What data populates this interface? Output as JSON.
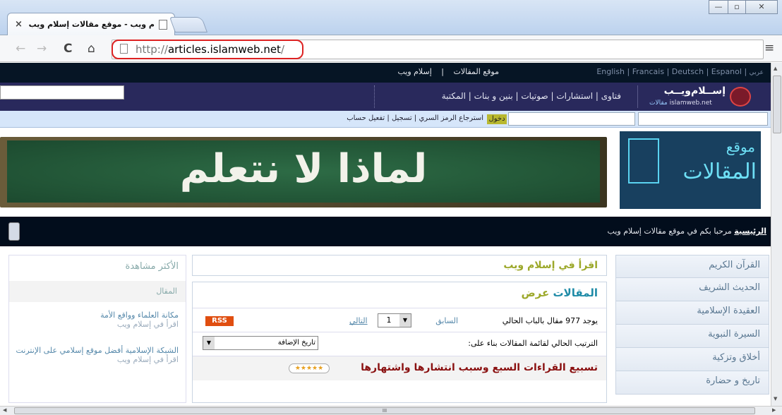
{
  "browser": {
    "tab_title": "م ويب - موقع مقالات إسلام ويب",
    "tab_close": "×",
    "url_scheme": "http://",
    "url_host": "articles.islamweb.net",
    "url_path": "/",
    "menu_icon": "≡"
  },
  "window": {
    "minimize": "—",
    "maximize": "▫",
    "close": "✕"
  },
  "topbar": {
    "langs": [
      "عربي",
      "Espanol",
      "Deutsch",
      "Francais",
      "English"
    ],
    "links": [
      "موقع المقالات",
      "إسلام ويب"
    ]
  },
  "header": {
    "logo_ar": "إســلام‌ويــب",
    "logo_sub": "مقالات",
    "logo_en": "islamweb.net",
    "nav": "فتاوى | استشارات | صوتيات | بنين و بنات | المكتبة"
  },
  "login": {
    "login_btn": "دخول",
    "recover": "استرجاع الرمز السري",
    "register": "تسجيل",
    "activate": "تفعيل حساب"
  },
  "banner": {
    "headline": "لماذا لا نتعلم",
    "site_label": "موقع",
    "site_name": "المقالات"
  },
  "breadcrumb": {
    "home": "الرئيسية",
    "welcome": "مرحبا بكم في موقع مقالات إسلام ويب"
  },
  "sidebar": {
    "items": [
      "القرآن الكريم",
      "الحديث الشريف",
      "العقيدة الإسلامية",
      "السيرة النبوية",
      "أخلاق وتزكية",
      "تاريخ و حضارة"
    ]
  },
  "main": {
    "read_title": "اقرأ في إسلام ويب",
    "view_title_a": "عرض",
    "view_title_b": "المقالات",
    "count_text": "يوجد 977 مقال بالباب الحالي",
    "prev": "السابق",
    "page": "1",
    "next": "التالي",
    "rss": "RSS",
    "sort_label": "الترتيب الحالي لقائمة المقالات بناء على:",
    "sort_value": "تاريخ الإضافة",
    "article_title": "تسبيع القراءات السبع وسبب انتشارها واشتهارها",
    "stars": "★★★★★"
  },
  "popular": {
    "title": "الأكثر مشاهدة",
    "col": "المقال",
    "items": [
      {
        "title": "مكانة العلماء وواقع الأمة",
        "src": "اقرأ في إسلام ويب"
      },
      {
        "title": "الشبكة الإسلامية أفضل موقع إسلامي على الإنترنت",
        "src": "اقرأ في إسلام ويب"
      }
    ]
  },
  "scroll": {
    "h_grip": "III"
  }
}
